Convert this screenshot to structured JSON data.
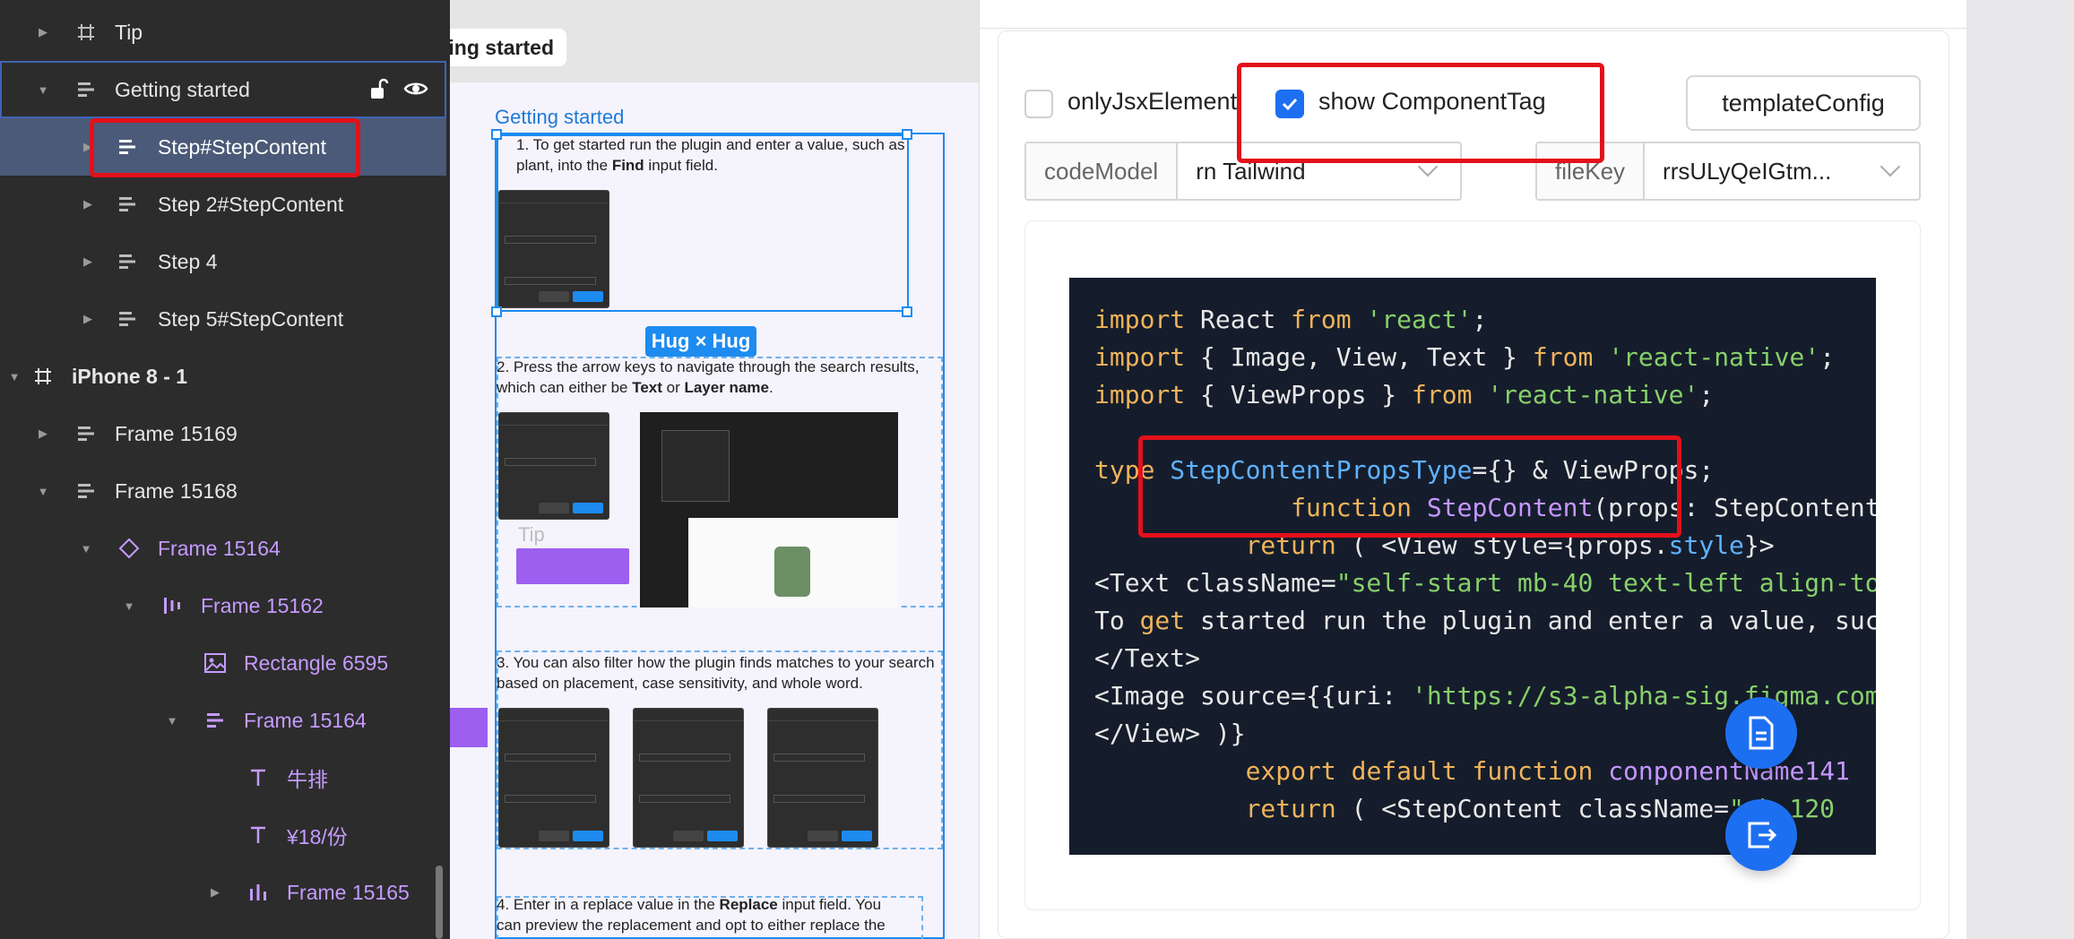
{
  "layers": [
    {
      "label": "Tip",
      "icon": "frame-hash-icon"
    },
    {
      "label": "Getting started",
      "icon": "auto-layout-icon"
    },
    {
      "label": "Step#StepContent",
      "icon": "auto-layout-icon"
    },
    {
      "label": "Step 2#StepContent",
      "icon": "auto-layout-icon"
    },
    {
      "label": "Step 4",
      "icon": "auto-layout-icon"
    },
    {
      "label": "Step 5#StepContent",
      "icon": "auto-layout-icon"
    },
    {
      "label": "iPhone 8 - 1",
      "icon": "frame-hash-icon"
    },
    {
      "label": "Frame 15169",
      "icon": "auto-layout-icon"
    },
    {
      "label": "Frame 15168",
      "icon": "auto-layout-icon"
    },
    {
      "label": "Frame 15164",
      "icon": "component-instance-icon"
    },
    {
      "label": "Frame 15162",
      "icon": "vertical-bars-icon"
    },
    {
      "label": "Rectangle 6595",
      "icon": "image-icon"
    },
    {
      "label": "Frame 15164",
      "icon": "auto-layout-icon"
    },
    {
      "label": "牛排",
      "icon": "text-icon"
    },
    {
      "label": "¥18/份",
      "icon": "text-icon"
    },
    {
      "label": "Frame 15165",
      "icon": "vertical-bars-icon"
    }
  ],
  "canvas": {
    "frame_tag": "Getting started",
    "selection_title": "Getting started",
    "hug_badge": "Hug × Hug",
    "tip_label": "Tip",
    "step1_line1": "1. To get started run the plugin and enter a value, such as",
    "step1_line2_pre": "plant, into the ",
    "step1_line2_bold": "Find",
    "step1_line2_post": " input field.",
    "step2_line1": "2. Press the arrow keys to navigate through the search results,",
    "step2_line2_pre": "which can either be ",
    "step2_bold1": "Text",
    "step2_mid": " or ",
    "step2_bold2": "Layer name",
    "step2_end": ".",
    "step3_line1": "3. You can also filter how the plugin finds matches to your search",
    "step3_line2": "based on placement, case sensitivity, and whole word.",
    "step4_line1_pre": "4. Enter in a replace value in the ",
    "step4_bold": "Replace",
    "step4_line1_post": " input field. You",
    "step4_line2": "can preview the replacement and opt to either replace the"
  },
  "panel": {
    "only_jsx_label": "onlyJsxElement",
    "only_jsx_checked": false,
    "show_tag_label": "show ComponentTag",
    "show_tag_checked": true,
    "template_button": "templateConfig",
    "code_model_label": "codeModel",
    "code_model_value": "rn Tailwind",
    "file_key_label": "fileKey",
    "file_key_value": "rrsULyQeIGtm..."
  },
  "code": {
    "l1": [
      "import",
      " React ",
      "from",
      " ",
      "'react'",
      ";"
    ],
    "l2": [
      "import",
      " { Image, View, Text } ",
      "from",
      " ",
      "'react-native'",
      ";"
    ],
    "l3": [
      "import",
      " { ViewProps } ",
      "from",
      " ",
      "'react-native'",
      ";"
    ],
    "l4": [
      "type",
      " ",
      "StepContentPropsType",
      "={} & ViewProps;"
    ],
    "l5": [
      "             ",
      "function",
      " ",
      "StepContent",
      "(props: StepContent"
    ],
    "l6": [
      "          ",
      "return",
      " ( <View style={props.",
      "style",
      "}>"
    ],
    "l7": [
      "<Text className=",
      "\"self-start mb-40 text-left align-to"
    ],
    "l8": [
      "To ",
      "get",
      " started run the plugin and enter a value, such"
    ],
    "l9": [
      "</Text>"
    ],
    "l10": [
      "<Image source={{uri: ",
      "'https://s3-alpha-sig.figma.com"
    ],
    "l11": [
      "</View> )}"
    ],
    "l12": [
      "          ",
      "export",
      " ",
      "default",
      " ",
      "function",
      " ",
      "conponentName141"
    ],
    "l13": [
      "          ",
      "return",
      " ( <StepContent classNam",
      "e=",
      "\"mb-120"
    ]
  },
  "colors": {
    "accent": "#1d6ff2",
    "selection": "#1d8bf0",
    "highlight_red": "#e3101a",
    "code_bg": "#151d2c"
  }
}
